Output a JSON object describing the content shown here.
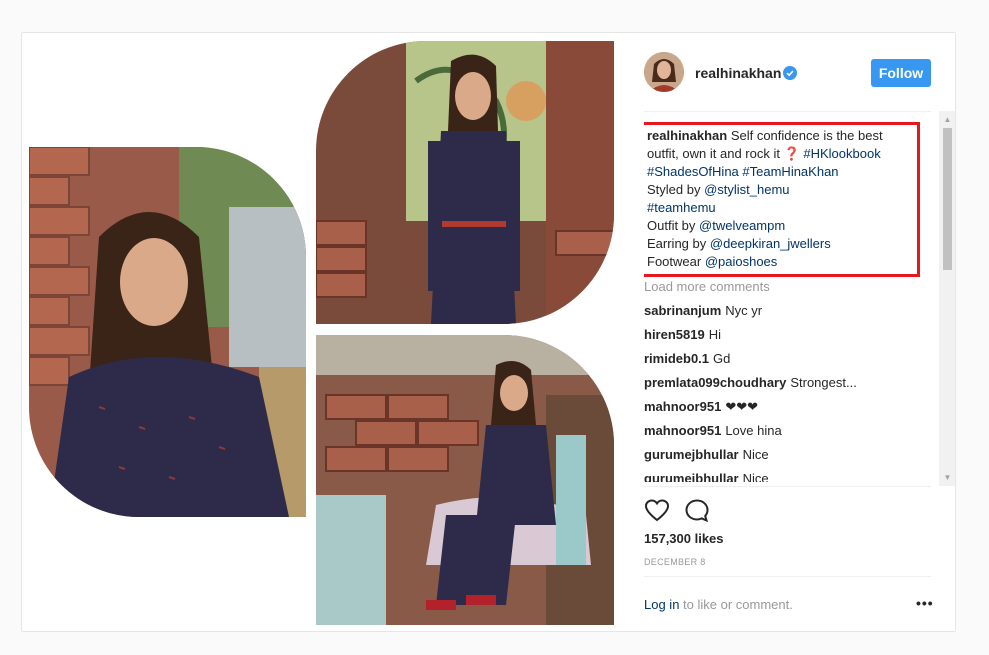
{
  "post": {
    "username": "realhinakhan",
    "follow_label": "Follow",
    "caption": {
      "lines": [
        {
          "prefix_user": "realhinakhan",
          "text": " Self confidence is the best"
        },
        {
          "text": "outfit, own it and rock it ❓ ",
          "tag": "#HKlookbook"
        },
        {
          "tag": "#ShadesOfHina",
          "tag2": "#TeamHinaKhan"
        },
        {
          "text": "Styled by ",
          "tag": "@stylist_hemu"
        },
        {
          "tag": "#teamhemu"
        },
        {
          "text": "Outfit by ",
          "tag": "@twelveampm"
        },
        {
          "text": "Earring by ",
          "tag": "@deepkiran_jwellers"
        },
        {
          "text": "Footwear ",
          "tag": "@paioshoes"
        }
      ]
    },
    "load_more": "Load more comments",
    "comments": [
      {
        "user": "sabrinanjum",
        "text": "Nyc yr"
      },
      {
        "user": "hiren5819",
        "text": "Hi"
      },
      {
        "user": "rimideb0.1",
        "text": "Gd"
      },
      {
        "user": "premlata099choudhary",
        "text": "Strongest..."
      },
      {
        "user": "mahnoor951",
        "text": "❤❤❤"
      },
      {
        "user": "mahnoor951",
        "text": "Love hina"
      },
      {
        "user": "gurumejbhullar",
        "text": "Nice"
      },
      {
        "user": "gurumejbhullar",
        "text": "Nice"
      }
    ],
    "likes": "157,300 likes",
    "date": "DECEMBER 8",
    "login_link": "Log in",
    "login_rest": " to like or comment.",
    "more_label": "•••"
  },
  "icons": [
    "verified-badge-icon",
    "heart-icon",
    "comment-icon",
    "scroll-up-icon",
    "scroll-down-icon",
    "more-options-icon"
  ],
  "colors": {
    "follow_bg": "#3897f0",
    "highlight_box": "#e8171f",
    "link": "#003569",
    "muted": "#999999"
  }
}
